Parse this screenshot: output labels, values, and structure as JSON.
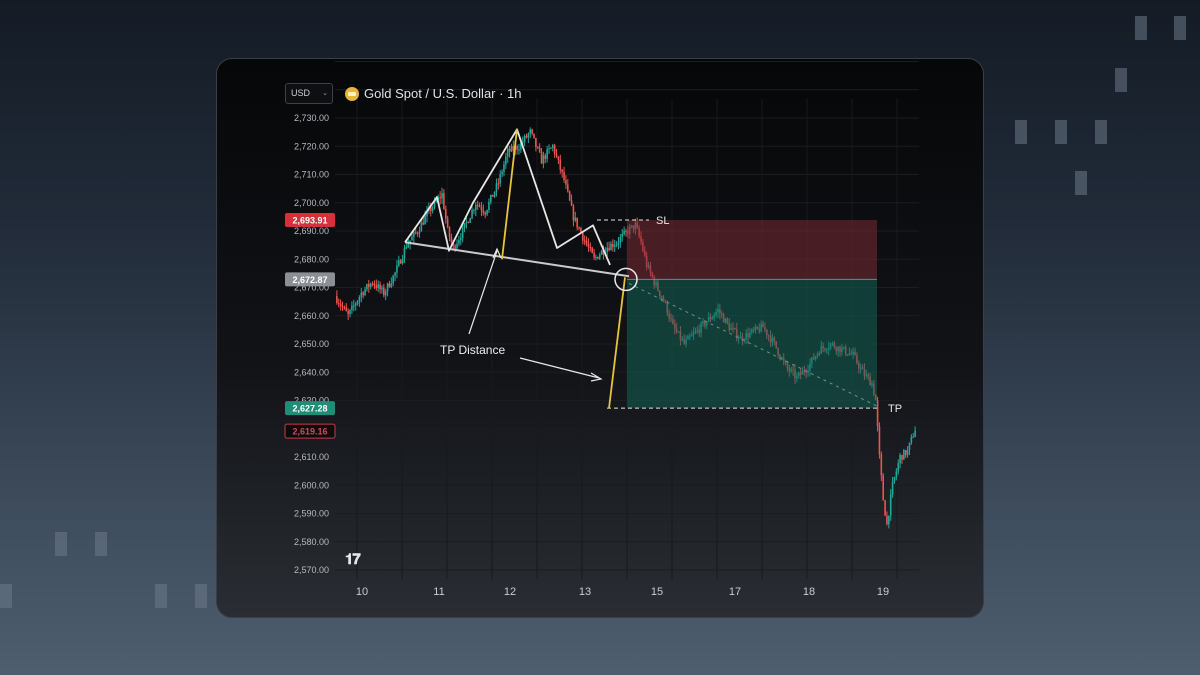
{
  "header": {
    "currency_select": "USD",
    "symbol": "Gold Spot / U.S. Dollar · 1h"
  },
  "colors": {
    "up": "#26a69a",
    "down": "#ef5350",
    "sl_zone": "#7a2a33",
    "tp_zone": "#146356",
    "pattern_line": "#e6e6e6",
    "tp_distance_line": "#e8c33c"
  },
  "chart_data": {
    "type": "candlestick",
    "title": "Gold Spot / U.S. Dollar · 1h",
    "ylim": [
      2565,
      2735
    ],
    "y_ticks": [
      "2,730.00",
      "2,720.00",
      "2,710.00",
      "2,700.00",
      "2,690.00",
      "2,680.00",
      "2,670.00",
      "2,660.00",
      "2,650.00",
      "2,640.00",
      "2,630.00",
      "2,620.00",
      "2,610.00",
      "2,600.00",
      "2,590.00",
      "2,580.00",
      "2,570.00"
    ],
    "x_ticks": [
      "10",
      "11",
      "12",
      "13",
      "15",
      "17",
      "18",
      "19"
    ],
    "price_badges": [
      {
        "label": "2,693.91",
        "value": 2693.91,
        "style": "red"
      },
      {
        "label": "2,672.87",
        "value": 2672.87,
        "style": "gray"
      },
      {
        "label": "2,627.28",
        "value": 2627.28,
        "style": "green"
      },
      {
        "label": "2,619.16",
        "value": 2619.16,
        "style": "red-outline"
      }
    ],
    "stop_loss": 2693.91,
    "entry": 2672.87,
    "take_profit": 2627.28,
    "annotations": [
      {
        "text": "SL"
      },
      {
        "text": "TP"
      },
      {
        "text": "TP Distance"
      }
    ],
    "pattern": "head-and-shoulders",
    "close_path": [
      [
        0,
        2667
      ],
      [
        7,
        2660
      ],
      [
        14,
        2668
      ],
      [
        20,
        2672
      ],
      [
        26,
        2668
      ],
      [
        32,
        2675
      ],
      [
        38,
        2685
      ],
      [
        44,
        2690
      ],
      [
        50,
        2697
      ],
      [
        57,
        2703
      ],
      [
        60,
        2690
      ],
      [
        63,
        2684
      ],
      [
        68,
        2690
      ],
      [
        75,
        2700
      ],
      [
        80,
        2697
      ],
      [
        87,
        2707
      ],
      [
        92,
        2718
      ],
      [
        98,
        2720
      ],
      [
        104,
        2725
      ],
      [
        110,
        2715
      ],
      [
        116,
        2720
      ],
      [
        122,
        2708
      ],
      [
        127,
        2695
      ],
      [
        132,
        2688
      ],
      [
        138,
        2680
      ],
      [
        144,
        2684
      ],
      [
        150,
        2686
      ],
      [
        156,
        2690
      ],
      [
        160,
        2692
      ],
      [
        163,
        2686
      ],
      [
        166,
        2678
      ],
      [
        170,
        2672
      ],
      [
        176,
        2664
      ],
      [
        180,
        2656
      ],
      [
        186,
        2650
      ],
      [
        192,
        2654
      ],
      [
        198,
        2658
      ],
      [
        204,
        2662
      ],
      [
        210,
        2656
      ],
      [
        216,
        2652
      ],
      [
        222,
        2654
      ],
      [
        228,
        2656
      ],
      [
        234,
        2650
      ],
      [
        240,
        2642
      ],
      [
        246,
        2638
      ],
      [
        252,
        2642
      ],
      [
        258,
        2648
      ],
      [
        264,
        2650
      ],
      [
        270,
        2648
      ],
      [
        276,
        2646
      ],
      [
        281,
        2640
      ],
      [
        286,
        2636
      ],
      [
        288,
        2630
      ],
      [
        290,
        2610
      ],
      [
        292,
        2595
      ],
      [
        294,
        2586
      ],
      [
        297,
        2600
      ],
      [
        301,
        2610
      ],
      [
        305,
        2612
      ],
      [
        309,
        2620
      ]
    ]
  }
}
